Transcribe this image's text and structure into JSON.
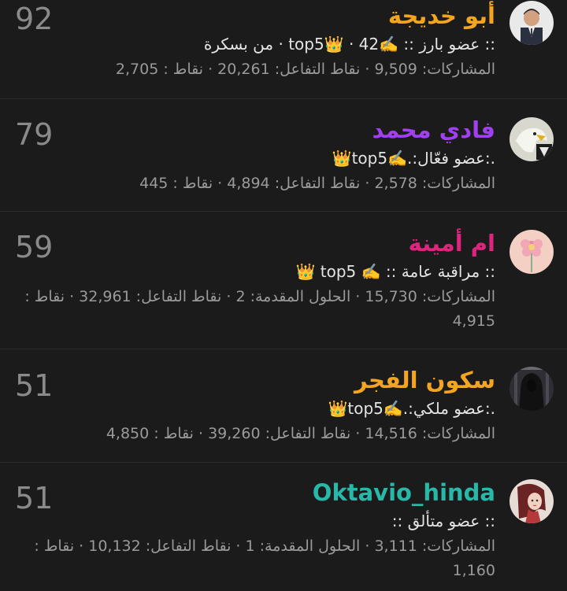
{
  "members": [
    {
      "rank": "92",
      "name": "أبو خديجة",
      "name_color": "#f3a51f",
      "title_text": ":: عضو بارز :: ✍️top5👑 · 42 · من بسكرة",
      "stats_text": "المشاركات: 9,509 · نقاط التفاعل: 20,261 · نقاط : 2,705",
      "avatar_icon": "user-photo-man-suit"
    },
    {
      "rank": "79",
      "name": "فادي محمد",
      "name_color": "#a040f0",
      "title_text": ".:عضو فعّال:.✍️top5👑",
      "stats_text": "المشاركات: 2,578 · نقاط التفاعل: 4,894 · نقاط : 445",
      "avatar_icon": "user-photo-eagle"
    },
    {
      "rank": "59",
      "name": "ام أمينة",
      "name_color": "#e0247e",
      "title_text": ":: مراقبة عامة :: ✍️ top5 👑",
      "stats_text": "المشاركات: 15,730 · الحلول المقدمة: 2 · نقاط التفاعل: 32,961 · نقاط : 4,915",
      "avatar_icon": "user-photo-flower"
    },
    {
      "rank": "51",
      "name": "سكون الفجر",
      "name_color": "#f3a51f",
      "title_text": ".:عضو ملكي:.✍️top5👑",
      "stats_text": "المشاركات: 14,516 · نقاط التفاعل: 39,260 · نقاط : 4,850",
      "avatar_icon": "user-photo-hooded-figure"
    },
    {
      "rank": "51",
      "name": "Oktavio_hinda",
      "name_color": "#28b8a8",
      "title_text": ":: عضو متألق ::",
      "stats_text": "المشاركات: 3,111 · الحلول المقدمة: 1 · نقاط التفاعل: 10,132 · نقاط : 1,160",
      "avatar_icon": "user-photo-portrait-art"
    }
  ]
}
